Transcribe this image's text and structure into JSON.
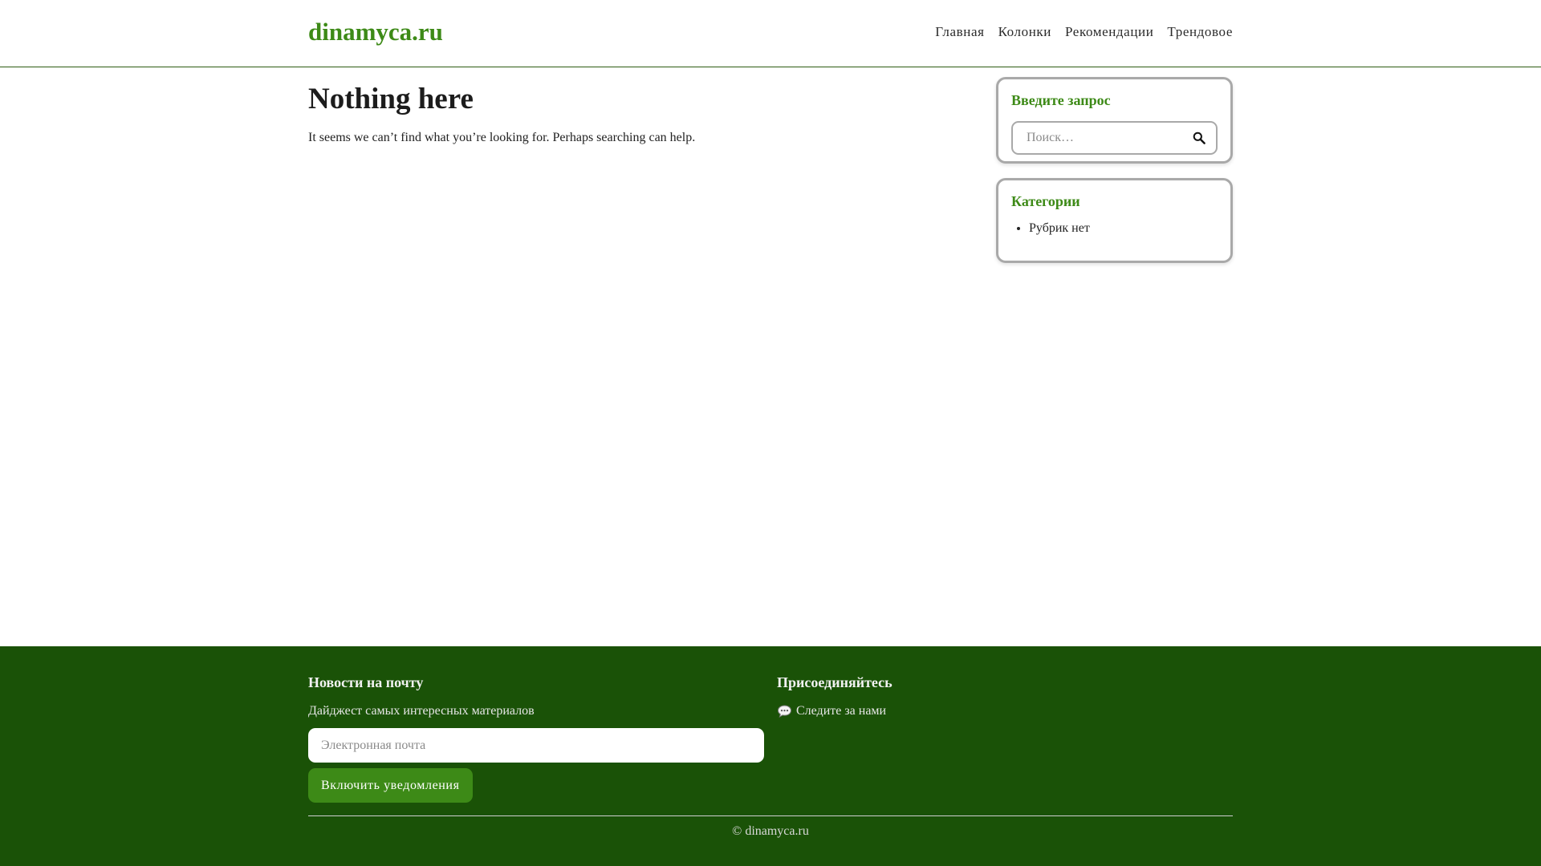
{
  "header": {
    "logo": "dinamyca.ru",
    "nav": [
      "Главная",
      "Колонки",
      "Рекомендации",
      "Трендовое"
    ]
  },
  "main": {
    "title": "Nothing here",
    "text": "It seems we can’t find what you’re looking for. Perhaps searching can help."
  },
  "sidebar": {
    "search": {
      "title": "Введите запрос",
      "placeholder": "Поиск…",
      "button_icon": "search-icon"
    },
    "categories": {
      "title": "Категории",
      "items": [
        "Рубрик нет"
      ]
    }
  },
  "footer": {
    "newsletter": {
      "title": "Новости на почту",
      "text": "Дайджест самых интересных материалов",
      "email_placeholder": "Электронная почта",
      "button_label": "Включить уведомления"
    },
    "social": {
      "title": "Присоединяйтесь",
      "link_label": "Следите за нами",
      "link_icon": "speech-bubble-icon"
    },
    "copyright": "© dinamyca.ru"
  },
  "colors": {
    "accent": "#3d8a17",
    "footer_bg": "#1a5207"
  }
}
